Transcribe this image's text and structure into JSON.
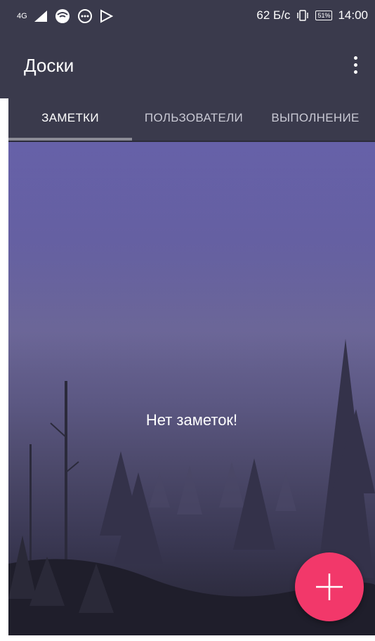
{
  "status_bar": {
    "network_label": "4G",
    "speed": "62 Б/с",
    "battery": "51%",
    "time": "14:00",
    "icons": [
      "signal-icon",
      "wifi-icon",
      "chat-icon",
      "play-store-icon",
      "vibrate-icon",
      "battery-icon"
    ]
  },
  "app_bar": {
    "title": "Доски",
    "overflow_icon": "more-vert-icon"
  },
  "tabs": [
    {
      "label": "ЗАМЕТКИ",
      "selected": true
    },
    {
      "label": "ПОЛЬЗОВАТЕЛИ",
      "selected": false
    },
    {
      "label": "ВЫПОЛНЕНИЕ",
      "selected": false
    }
  ],
  "content": {
    "empty_message": "Нет заметок!"
  },
  "fab": {
    "icon": "plus-icon",
    "color": "#f2386a"
  },
  "colors": {
    "app_bar": "#3a3a4c",
    "accent": "#f2386a"
  }
}
